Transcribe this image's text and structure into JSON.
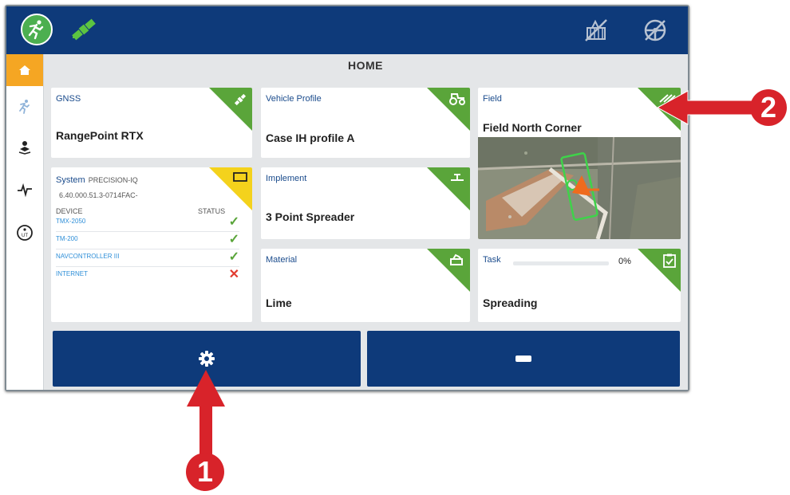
{
  "page": {
    "title": "HOME"
  },
  "topbar": {
    "left_icons": [
      "runner-icon",
      "satellite-icon"
    ],
    "right_icons": [
      "field-crossed-icon",
      "steering-wheel-crossed-icon"
    ]
  },
  "sidebar": {
    "items": [
      {
        "icon": "home-icon",
        "active": true
      },
      {
        "icon": "runner-icon",
        "active": false
      },
      {
        "icon": "operator-icon",
        "active": false
      },
      {
        "icon": "pulse-icon",
        "active": false
      },
      {
        "icon": "ut-icon",
        "label": "UT",
        "active": false
      }
    ]
  },
  "cards": {
    "gnss": {
      "label": "GNSS",
      "value": "RangePoint RTX"
    },
    "vehicle": {
      "label": "Vehicle Profile",
      "value": "Case IH profile A"
    },
    "field": {
      "label": "Field",
      "value": "Field North Corner"
    },
    "system": {
      "label": "System",
      "sublabel": "PRECISION-IQ",
      "version": "6.40.000.51.3-0714FAC-",
      "col_device": "DEVICE",
      "col_status": "STATUS",
      "devices": [
        {
          "name": "TMX-2050",
          "status": "ok"
        },
        {
          "name": "TM-200",
          "status": "ok"
        },
        {
          "name": "NAVCONTROLLER III",
          "status": "ok"
        },
        {
          "name": "INTERNET",
          "status": "error"
        }
      ]
    },
    "implement": {
      "label": "Implement",
      "value": "3 Point Spreader"
    },
    "material": {
      "label": "Material",
      "value": "Lime"
    },
    "task": {
      "label": "Task",
      "progress": 0,
      "progress_text": "0%",
      "value": "Spreading"
    }
  },
  "buttons": {
    "left_icon": "gear-icon",
    "right_icon": "minus-icon"
  },
  "annotations": {
    "one": "1",
    "two": "2"
  },
  "colors": {
    "header": "#0e3a7a",
    "accent": "#f5a623",
    "ok": "#5aa53a",
    "error": "#e23b2f",
    "callout": "#d8232a"
  }
}
